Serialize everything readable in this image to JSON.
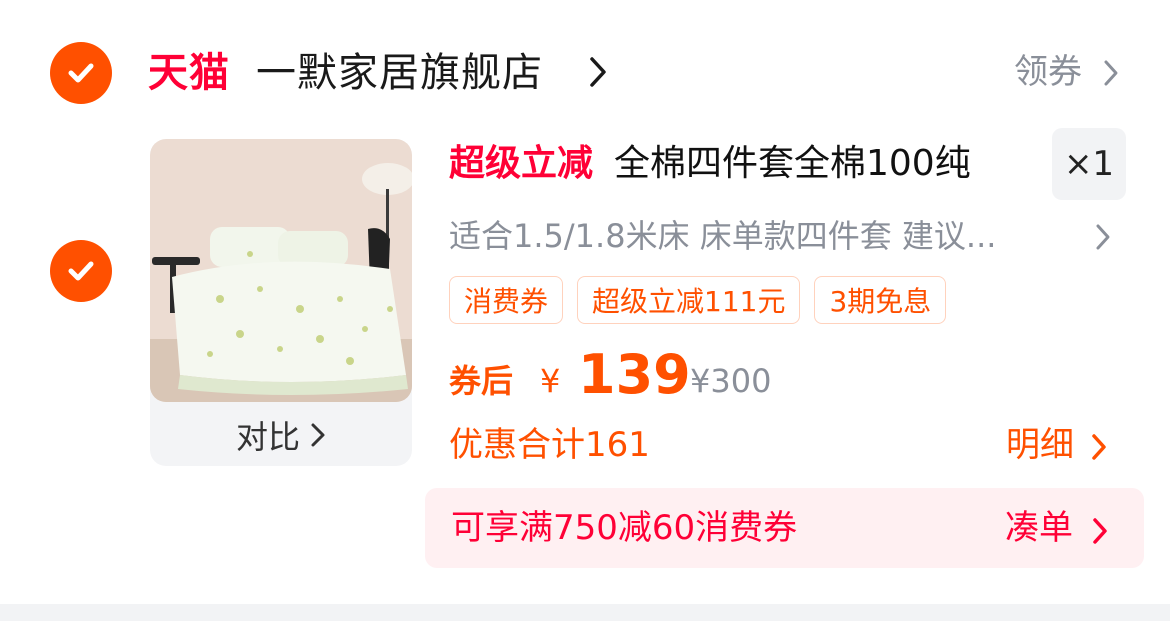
{
  "shop": {
    "brand": "天猫",
    "name": "一默家居旗舰店",
    "coupon_link": "领券"
  },
  "product": {
    "promo_tag": "超级立减",
    "title": "全棉四件套全棉100纯",
    "quantity": "×1",
    "spec": "适合1.5/1.8米床 床单款四件套 建议...",
    "compare_label": "对比",
    "tags": [
      "消费券",
      "超级立减111元",
      "3期免息"
    ],
    "price_label": "券后",
    "currency": "¥",
    "price": "139",
    "original_price": "¥300",
    "discount_total": "优惠合计161",
    "detail_label": "明细"
  },
  "banner": {
    "text": "可享满750减60消费券",
    "action": "凑单"
  },
  "colors": {
    "accent": "#ff5000",
    "tmall_red": "#ff0036",
    "muted": "#8a8f99"
  }
}
